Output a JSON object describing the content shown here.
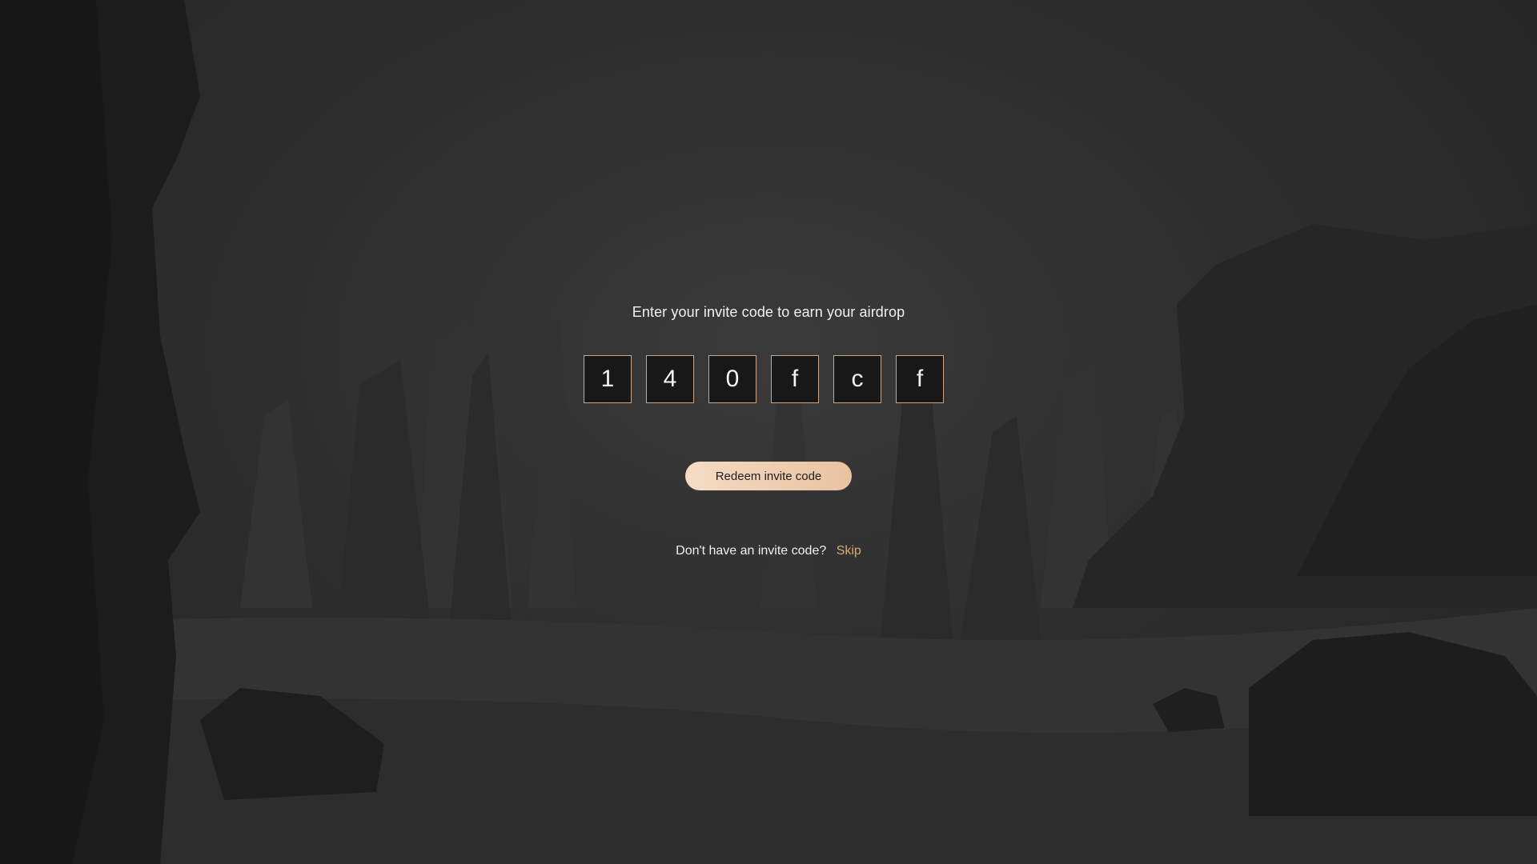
{
  "prompt": {
    "text": "Enter your invite code to earn your airdrop"
  },
  "invite_code": {
    "digits": [
      "1",
      "4",
      "0",
      "f",
      "c",
      "f"
    ]
  },
  "actions": {
    "redeem_label": "Redeem invite code",
    "no_code_text": "Don't have an invite code?",
    "skip_label": "Skip"
  },
  "theme": {
    "accent": "#e9c2a0",
    "link": "#d9a877",
    "box_border": "#c8a787"
  }
}
